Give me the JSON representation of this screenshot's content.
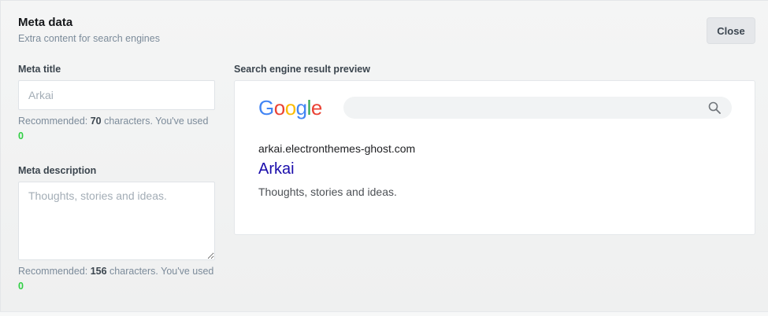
{
  "header": {
    "title": "Meta data",
    "subtitle": "Extra content for search engines",
    "close_label": "Close"
  },
  "meta_title": {
    "label": "Meta title",
    "value": "",
    "placeholder": "Arkai",
    "hint_prefix": "Recommended: ",
    "recommended": "70",
    "hint_middle": " characters. You've used ",
    "used": "0"
  },
  "meta_description": {
    "label": "Meta description",
    "value": "",
    "placeholder": "Thoughts, stories and ideas.",
    "hint_prefix": "Recommended: ",
    "recommended": "156",
    "hint_middle": " characters. You've used ",
    "used": "0"
  },
  "preview": {
    "label": "Search engine result preview",
    "logo_letters": [
      "G",
      "o",
      "o",
      "g",
      "l",
      "e"
    ],
    "logo_colors": [
      "#4285f4",
      "#ea4335",
      "#fbbc05",
      "#4285f4",
      "#34a853",
      "#ea4335"
    ],
    "search_icon": "search-icon",
    "url": "arkai.electronthemes-ghost.com",
    "title": "Arkai",
    "description": "Thoughts, stories and ideas."
  },
  "colors": {
    "used_count": "#30cf43",
    "result_title": "#1a0dab"
  }
}
